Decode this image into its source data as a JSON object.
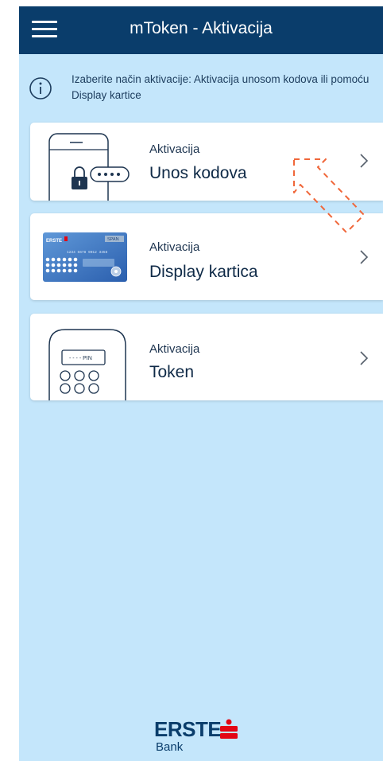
{
  "header": {
    "title": "mToken - Aktivacija",
    "menu_icon": "hamburger-menu-icon"
  },
  "info": {
    "icon": "info-icon",
    "text": "Izaberite način aktivacije: Aktivacija unosom kodova ili pomoću Display kartice"
  },
  "options": [
    {
      "small": "Aktivacija",
      "title": "Unos kodova",
      "icon": "phone-lock-icon"
    },
    {
      "small": "Aktivacija",
      "title": "Display kartica",
      "icon": "display-card-icon"
    },
    {
      "small": "Aktivacija",
      "title": "Token",
      "icon": "token-device-icon"
    }
  ],
  "display_card": {
    "brand": "ERSTE",
    "badge": "SPAN",
    "number": "1234 5678 9012 3456"
  },
  "token_device": {
    "pin_text": "- - - - PIN"
  },
  "footer": {
    "brand_name": "ERSTE",
    "brand_sub": "Bank"
  },
  "colors": {
    "header_bg": "#0a3d6b",
    "screen_bg": "#c4e6fb",
    "card_bg": "#ffffff",
    "annotation_arrow": "#f0673a",
    "brand_red": "#e30613"
  }
}
